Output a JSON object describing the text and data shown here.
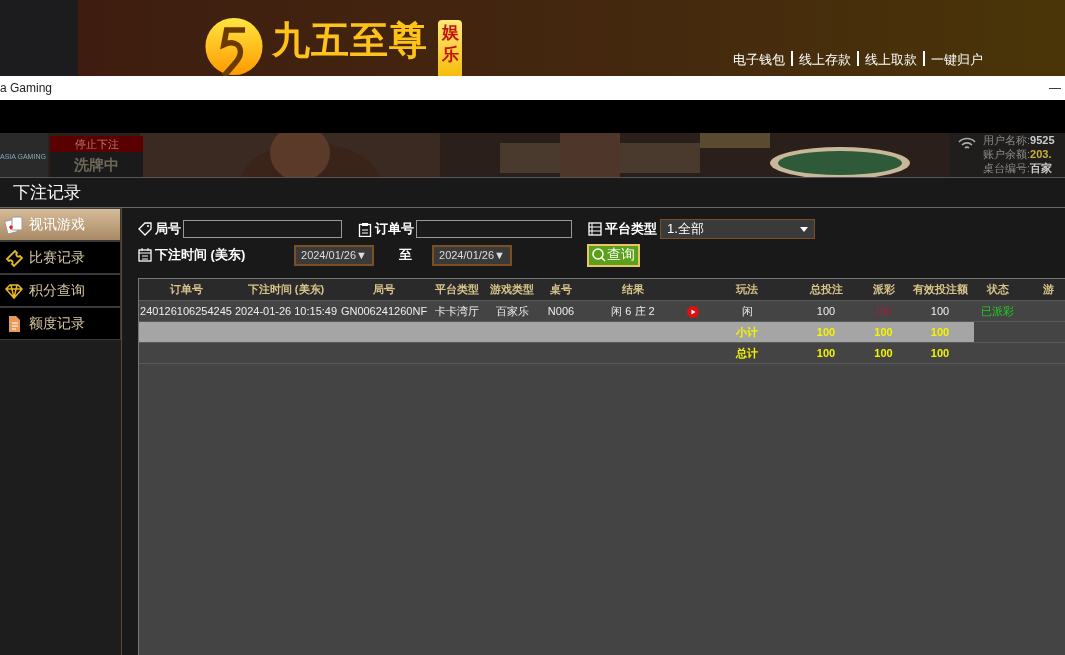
{
  "banner": {
    "brand": "九五至尊",
    "badge": "娱乐",
    "links": [
      "电子钱包",
      "线上存款",
      "线上取款",
      "一键归户"
    ]
  },
  "window": {
    "title": "a Gaming",
    "minimize": "—"
  },
  "video": {
    "logo_caption": "ASIA GAMING",
    "status": "停止下注",
    "phase": "洗牌中",
    "info": [
      {
        "label": "用户名称:",
        "value": "9525"
      },
      {
        "label": "账户余额:",
        "value": "203."
      },
      {
        "label": "桌台编号:",
        "value": "百家"
      }
    ]
  },
  "dialog": {
    "title": "下注记录",
    "sidebar": [
      {
        "label": "视讯游戏",
        "kind": "cards",
        "selected": true
      },
      {
        "label": "比赛记录",
        "kind": "ticket",
        "selected": false
      },
      {
        "label": "积分查询",
        "kind": "diamond",
        "selected": false
      },
      {
        "label": "额度记录",
        "kind": "document",
        "selected": false
      }
    ],
    "filters": {
      "round_label": "局号",
      "order_label": "订单号",
      "platform_label": "平台类型",
      "platform_value": "1.全部",
      "time_label": "下注时间 (美东)",
      "date_from": "2024/01/26▼",
      "to_label": "至",
      "date_to": "2024/01/26▼",
      "query_button": "查询"
    },
    "table": {
      "columns": [
        "订单号",
        "下注时间 (美东)",
        "局号",
        "平台类型",
        "游戏类型",
        "桌号",
        "结果",
        "",
        "玩法",
        "总投注",
        "派彩",
        "有效投注额",
        "状态",
        "游"
      ],
      "rows": [
        [
          "240126106254245",
          "2024-01-26 10:15:49",
          "GN006241260NF",
          "卡卡湾厅",
          "百家乐",
          "N006",
          "闲 6 庄 2",
          "",
          "闲",
          "100",
          "100",
          "100",
          "已派彩",
          ""
        ]
      ],
      "subtotal": {
        "label": "小计",
        "total_bet": "100",
        "payout": "100",
        "valid_bet": "100"
      },
      "total": {
        "label": "总计",
        "total_bet": "100",
        "payout": "100",
        "valid_bet": "100"
      }
    }
  }
}
